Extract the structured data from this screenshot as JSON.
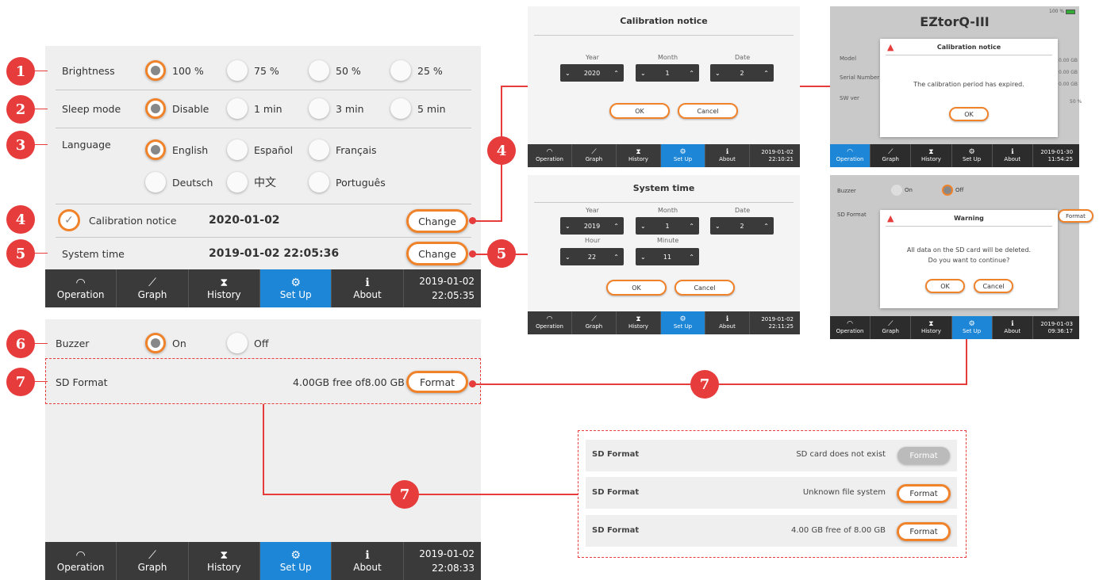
{
  "badges": [
    "1",
    "2",
    "3",
    "4",
    "5",
    "6",
    "7"
  ],
  "main": {
    "brightness": {
      "label": "Brightness",
      "options": [
        "100 %",
        "75 %",
        "50 %",
        "25 %"
      ]
    },
    "sleep": {
      "label": "Sleep mode",
      "options": [
        "Disable",
        "1 min",
        "3 min",
        "5 min"
      ]
    },
    "language": {
      "label": "Language",
      "options": [
        "English",
        "Español",
        "Français",
        "Deutsch",
        "中文",
        "Português"
      ]
    },
    "calibration": {
      "label": "Calibration notice",
      "value": "2020-01-02",
      "button": "Change"
    },
    "systime": {
      "label": "System time",
      "value": "2019-01-02 22:05:36",
      "button": "Change"
    },
    "nav": {
      "items": [
        "Operation",
        "Graph",
        "History",
        "Set Up",
        "About"
      ],
      "date": "2019-01-02",
      "time": "22:05:35"
    }
  },
  "second": {
    "buzzer": {
      "label": "Buzzer",
      "on": "On",
      "off": "Off"
    },
    "sd": {
      "label": "SD Format",
      "value": "4.00GB free of8.00 GB",
      "button": "Format"
    },
    "nav": {
      "date": "2019-01-02",
      "time": "22:08:33"
    }
  },
  "cal_dialog": {
    "title": "Calibration notice",
    "year_label": "Year",
    "month_label": "Month",
    "date_label": "Date",
    "year": "2020",
    "month": "1",
    "date": "2",
    "ok": "OK",
    "cancel": "Cancel",
    "nav_date": "2019-01-02",
    "nav_time": "22:10:21"
  },
  "time_dialog": {
    "title": "System time",
    "year_label": "Year",
    "month_label": "Month",
    "date_label": "Date",
    "hour_label": "Hour",
    "minute_label": "Minute",
    "year": "2019",
    "month": "1",
    "date": "2",
    "hour": "22",
    "minute": "11",
    "ok": "OK",
    "cancel": "Cancel",
    "nav_date": "2019-01-02",
    "nav_time": "22:11:25"
  },
  "eztorq": {
    "title": "EZtorQ-III",
    "battery": "100 %",
    "rows": [
      "Model",
      "Serial Number",
      "SW ver"
    ],
    "right": [
      "0.00 GB",
      "0.00 GB",
      "0.00 GB",
      "50 %"
    ],
    "dialog_title": "Calibration notice",
    "dialog_msg": "The calibration period has expired.",
    "ok": "OK",
    "nav_date": "2019-01-30",
    "nav_time": "11:54:25"
  },
  "warning": {
    "buzzer": "Buzzer",
    "on": "On",
    "off": "Off",
    "sd": "SD Format",
    "format": "Format",
    "title": "Warning",
    "msg1": "All data on the SD card will be deleted.",
    "msg2": "Do you want to continue?",
    "ok": "OK",
    "cancel": "Cancel",
    "nav_date": "2019-01-03",
    "nav_time": "09:36:17"
  },
  "sd_states": [
    {
      "label": "SD Format",
      "status": "SD card does not exist",
      "button": "Format"
    },
    {
      "label": "SD Format",
      "status": "Unknown file system",
      "button": "Format"
    },
    {
      "label": "SD Format",
      "status": "4.00 GB free of 8.00 GB",
      "button": "Format"
    }
  ]
}
